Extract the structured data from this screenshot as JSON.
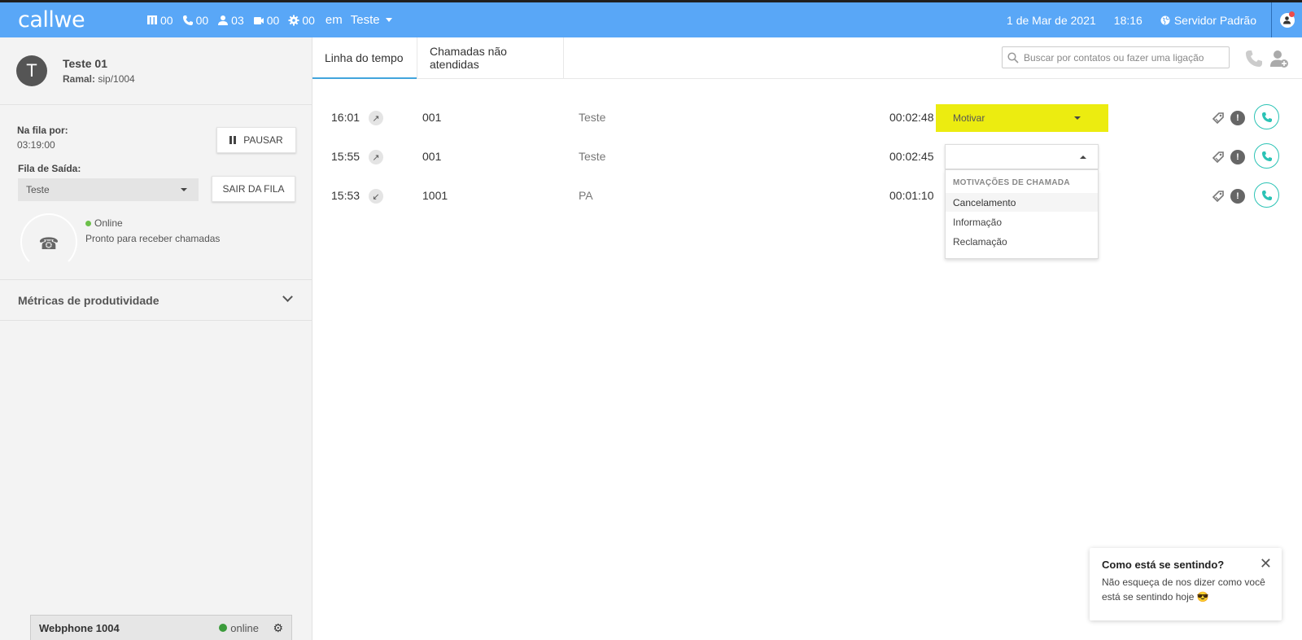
{
  "app": {
    "logo": "callwe"
  },
  "topbar": {
    "counters": [
      {
        "icon": "queue-icon",
        "value": "00"
      },
      {
        "icon": "phone-icon",
        "value": "00"
      },
      {
        "icon": "user-icon",
        "value": "03"
      },
      {
        "icon": "video-icon",
        "value": "00"
      },
      {
        "icon": "gear-icon",
        "value": "00"
      }
    ],
    "em_label": "em",
    "queue_selected": "Teste",
    "date": "1 de Mar de 2021",
    "time": "18:16",
    "server": "Servidor Padrão",
    "accent": "#59a7f7"
  },
  "agent": {
    "avatar_letter": "T",
    "name": "Teste 01",
    "ramal_label": "Ramal:",
    "ramal_value": "sip/1004"
  },
  "queue": {
    "na_fila_label": "Na fila por:",
    "na_fila_value": "03:19:00",
    "pause_label": "PAUSAR",
    "fila_saida_label": "Fila de Saída:",
    "fila_saida_value": "Teste",
    "sair_label": "SAIR DA FILA",
    "status": "Online",
    "status_msg": "Pronto para receber chamadas",
    "status_color": "#6cc04a"
  },
  "metrics": {
    "title": "Métricas de produtividade"
  },
  "webphone": {
    "title": "Webphone 1004",
    "status": "online"
  },
  "tabs": [
    {
      "label": "Linha do tempo",
      "active": true
    },
    {
      "label": "Chamadas não atendidas",
      "active": false
    }
  ],
  "search": {
    "placeholder": "Buscar por contatos ou fazer uma ligação"
  },
  "timeline": [
    {
      "time": "16:01",
      "direction": "outgoing",
      "dir_glyph": "↗",
      "number": "001",
      "name": "Teste",
      "duration": "00:02:48"
    },
    {
      "time": "15:55",
      "direction": "outgoing",
      "dir_glyph": "↗",
      "number": "001",
      "name": "Teste",
      "duration": "00:02:45"
    },
    {
      "time": "15:53",
      "direction": "incoming",
      "dir_glyph": "↙",
      "number": "1001",
      "name": "PA",
      "duration": "00:01:10"
    }
  ],
  "motivar": {
    "label": "Motivar",
    "highlight_color": "#ecec10"
  },
  "dropdown": {
    "header": "MOTIVAÇÕES DE CHAMADA",
    "options": [
      "Cancelamento",
      "Informação",
      "Reclamação"
    ],
    "highlighted": "Cancelamento"
  },
  "toast": {
    "title": "Como está se sentindo?",
    "message": "Não esqueça de nos dizer como você está se sentindo hoje 😎"
  },
  "call_button_color": "#2bc3b5"
}
